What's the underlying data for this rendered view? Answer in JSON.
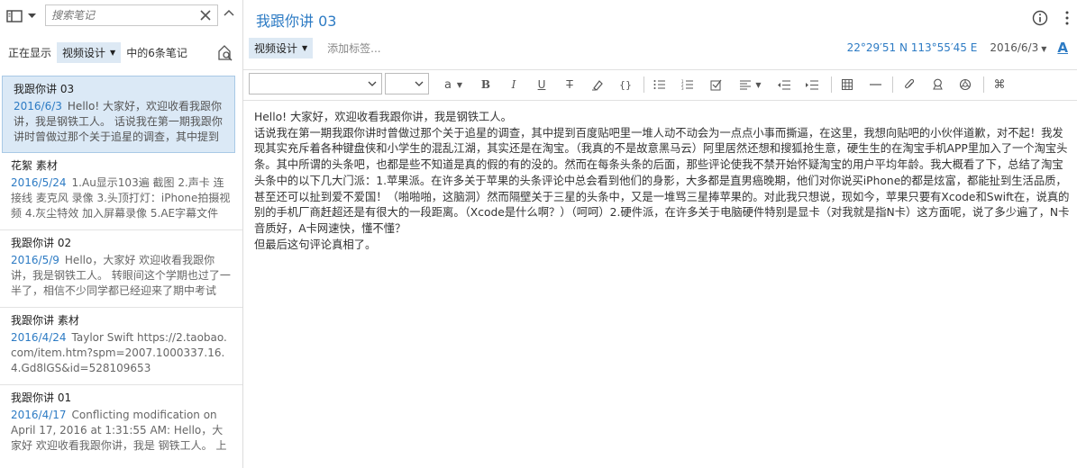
{
  "sidebar": {
    "search_placeholder": "搜索笔记",
    "filter": {
      "prefix": "正在显示",
      "tag": "视频设计",
      "suffix": "中的6条笔记"
    },
    "notes": [
      {
        "title": "我跟你讲 03",
        "date": "2016/6/3",
        "snippet": "Hello! 大家好，欢迎收看我跟你讲，我是钢铁工人。 话说我在第一期我跟你讲时曾做过那个关于追星的调查，其中提到百度贴吧里一堆人动不动会为一点点小事而撕逼",
        "selected": true
      },
      {
        "title": "花絮 素材",
        "date": "2016/5/24",
        "snippet": "1.Au显示103遍 截图 2.声卡 连接线 麦克风 录像 3.头顶打灯：iPhone拍摄视频 4.灰尘特效 加入屏幕录像 5.AE字幕文件",
        "selected": false
      },
      {
        "title": "我跟你讲 02",
        "date": "2016/5/9",
        "snippet": "Hello，大家好 欢迎收看我跟你讲，我是钢铁工人。 转眼间这个学期也过了一半了，相信不少同学都已经迎来了期中考试",
        "selected": false
      },
      {
        "title": "我跟你讲 素材",
        "date": "2016/4/24",
        "snippet": "Taylor Swift https://2.taobao.com/item.htm?spm=2007.1000337.16.4.Gd8lGS&id=528109653",
        "selected": false
      },
      {
        "title": "我跟你讲 01",
        "date": "2016/4/17",
        "snippet": "Conflicting modification on April 17, 2016 at 1:31:55 AM: Hello，大家好 欢迎收看我跟你讲，我是 钢铁工人。 上期",
        "selected": false
      }
    ]
  },
  "note": {
    "title": "我跟你讲 03",
    "tag": "视频设计",
    "add_tag_placeholder": "添加标签...",
    "location": "22°29′51 N  113°55′45 E",
    "date": "2016/6/3",
    "format_label": "A",
    "body": [
      "Hello! 大家好，欢迎收看我跟你讲，我是钢铁工人。",
      "话说我在第一期我跟你讲时曾做过那个关于追星的调查，其中提到百度贴吧里一堆人动不动会为一点点小事而撕逼，在这里，我想向贴吧的小伙伴道歉，对不起！我发现其实充斥着各种键盘侠和小学生的混乱江湖，其实还是在淘宝。（我真的不是故意黑马云）阿里居然还想和搜狐抢生意，硬生生的在淘宝手机APP里加入了一个淘宝头条。其中所谓的头条吧，也都是些不知道是真的假的有的没的。然而在每条头条的后面，那些评论使我不禁开始怀疑淘宝的用户平均年龄。我大概看了下，总结了淘宝头条中的以下几大门派：1.苹果派。在许多关于苹果的头条评论中总会看到他们的身影，大多都是直男癌晚期，他们对你说买iPhone的都是炫富，都能扯到生活品质，甚至还可以扯到爱不爱国！（啪啪啪，这脑洞）然而隔壁关于三星的头条中，又是一堆骂三星捧苹果的。对此我只想说，现如今，苹果只要有Xcode和Swift在，说真的别的手机厂商赶超还是有很大的一段距离。（Xcode是什么啊？）（呵呵）2.硬件派，在许多关于电脑硬件特别是显卡（对我就是指N卡）这方面呢，说了多少遍了，N卡音质好，A卡网速快，懂不懂？",
      "但最后这句评论真相了。"
    ]
  },
  "toolbar": {
    "font_value": "",
    "size_value": "",
    "buttons": [
      "text-color",
      "bold",
      "italic",
      "underline",
      "strikethrough",
      "highlight",
      "code",
      "bullet-list",
      "numbered-list",
      "checkbox",
      "align",
      "outdent",
      "indent",
      "table",
      "horizontal-rule",
      "attachment",
      "location",
      "record",
      "more"
    ]
  },
  "colors": {
    "accent": "#2d7bc4",
    "selected_bg": "#dbe9f6",
    "tag_bg": "#dde9f4"
  }
}
